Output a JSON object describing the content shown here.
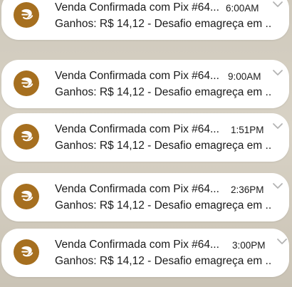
{
  "colors": {
    "background": "#d2ccbf",
    "card": "#ffffff",
    "icon": "#a66f1f",
    "text": "#1a1a1a",
    "chevron": "#b3b3b3"
  },
  "notifications": [
    {
      "app_icon": "coin-icon",
      "title": "Venda Confirmada com Pix #64...",
      "time": "6:00AM",
      "body": "Ganhos: R$ 14,12 - Desafio emagreça em .."
    },
    {
      "app_icon": "coin-icon",
      "title": "Venda Confirmada com Pix #64...",
      "time": "9:00AM",
      "body": "Ganhos: R$ 14,12 - Desafio emagreça em .."
    },
    {
      "app_icon": "coin-icon",
      "title": "Venda Confirmada com Pix #64...",
      "time": "1:51PM",
      "body": "Ganhos: R$ 14,12 - Desafio emagreça em .."
    },
    {
      "app_icon": "coin-icon",
      "title": "Venda Confirmada com Pix #64...",
      "time": "2:36PM",
      "body": "Ganhos: R$ 14,12 - Desafio emagreça em .."
    },
    {
      "app_icon": "coin-icon",
      "title": "Venda Confirmada com Pix #64...",
      "time": "3:00PM",
      "body": "Ganhos: R$ 14,12 - Desafio emagreça em .."
    }
  ]
}
